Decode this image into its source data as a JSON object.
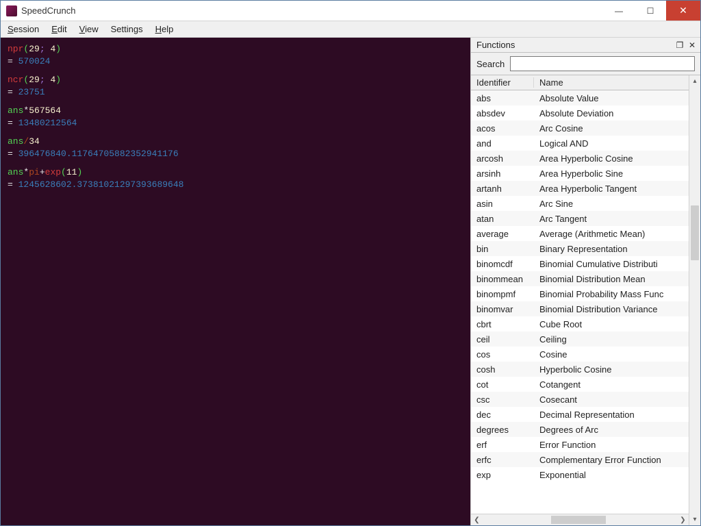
{
  "window": {
    "title": "SpeedCrunch"
  },
  "menu": {
    "session": "Session",
    "edit": "Edit",
    "view": "View",
    "settings": "Settings",
    "help": "Help"
  },
  "console": {
    "entries": [
      {
        "expr_tokens": [
          {
            "t": "fn",
            "v": "npr"
          },
          {
            "t": "paren",
            "v": "("
          },
          {
            "t": "num",
            "v": "29"
          },
          {
            "t": "sep",
            "v": "; "
          },
          {
            "t": "num",
            "v": "4"
          },
          {
            "t": "paren",
            "v": ")"
          }
        ],
        "result": "570024"
      },
      {
        "expr_tokens": [
          {
            "t": "fn",
            "v": "ncr"
          },
          {
            "t": "paren",
            "v": "("
          },
          {
            "t": "num",
            "v": "29"
          },
          {
            "t": "sep",
            "v": "; "
          },
          {
            "t": "num",
            "v": "4"
          },
          {
            "t": "paren",
            "v": ")"
          }
        ],
        "result": "23751"
      },
      {
        "expr_tokens": [
          {
            "t": "ans",
            "v": "ans"
          },
          {
            "t": "op",
            "v": "*"
          },
          {
            "t": "num",
            "v": "567564"
          }
        ],
        "result": "13480212564"
      },
      {
        "expr_tokens": [
          {
            "t": "ans",
            "v": "ans"
          },
          {
            "t": "div",
            "v": "/"
          },
          {
            "t": "num",
            "v": "34"
          }
        ],
        "result": "396476840.11764705882352941176"
      },
      {
        "expr_tokens": [
          {
            "t": "ans",
            "v": "ans"
          },
          {
            "t": "op",
            "v": "*"
          },
          {
            "t": "const",
            "v": "pi"
          },
          {
            "t": "op",
            "v": "+"
          },
          {
            "t": "fn",
            "v": "exp"
          },
          {
            "t": "paren",
            "v": "("
          },
          {
            "t": "num",
            "v": "11"
          },
          {
            "t": "paren",
            "v": ")"
          }
        ],
        "result": "1245628602.37381021297393689648"
      }
    ]
  },
  "panel": {
    "title": "Functions",
    "search_label": "Search",
    "search_value": "",
    "columns": {
      "id": "Identifier",
      "name": "Name"
    },
    "rows": [
      {
        "id": "abs",
        "name": "Absolute Value"
      },
      {
        "id": "absdev",
        "name": "Absolute Deviation"
      },
      {
        "id": "acos",
        "name": "Arc Cosine"
      },
      {
        "id": "and",
        "name": "Logical AND"
      },
      {
        "id": "arcosh",
        "name": "Area Hyperbolic Cosine"
      },
      {
        "id": "arsinh",
        "name": "Area Hyperbolic Sine"
      },
      {
        "id": "artanh",
        "name": "Area Hyperbolic Tangent"
      },
      {
        "id": "asin",
        "name": "Arc Sine"
      },
      {
        "id": "atan",
        "name": "Arc Tangent"
      },
      {
        "id": "average",
        "name": "Average (Arithmetic Mean)"
      },
      {
        "id": "bin",
        "name": "Binary Representation"
      },
      {
        "id": "binomcdf",
        "name": "Binomial Cumulative Distributi"
      },
      {
        "id": "binommean",
        "name": "Binomial Distribution Mean"
      },
      {
        "id": "binompmf",
        "name": "Binomial Probability Mass Func"
      },
      {
        "id": "binomvar",
        "name": "Binomial Distribution Variance"
      },
      {
        "id": "cbrt",
        "name": "Cube Root"
      },
      {
        "id": "ceil",
        "name": "Ceiling"
      },
      {
        "id": "cos",
        "name": "Cosine"
      },
      {
        "id": "cosh",
        "name": "Hyperbolic Cosine"
      },
      {
        "id": "cot",
        "name": "Cotangent"
      },
      {
        "id": "csc",
        "name": "Cosecant"
      },
      {
        "id": "dec",
        "name": "Decimal Representation"
      },
      {
        "id": "degrees",
        "name": "Degrees of Arc"
      },
      {
        "id": "erf",
        "name": "Error Function"
      },
      {
        "id": "erfc",
        "name": "Complementary Error Function"
      },
      {
        "id": "exp",
        "name": "Exponential"
      }
    ]
  }
}
